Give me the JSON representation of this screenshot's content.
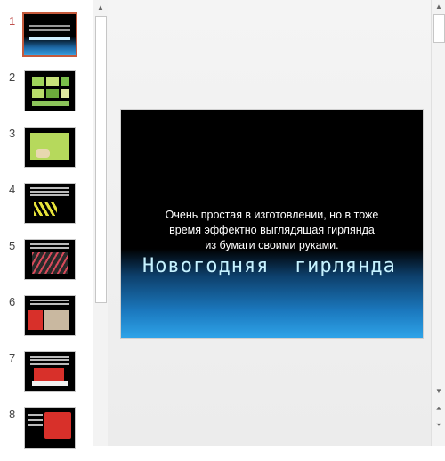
{
  "thumbnails": [
    {
      "number": "1",
      "selected": true
    },
    {
      "number": "2",
      "selected": false
    },
    {
      "number": "3",
      "selected": false
    },
    {
      "number": "4",
      "selected": false
    },
    {
      "number": "5",
      "selected": false
    },
    {
      "number": "6",
      "selected": false
    },
    {
      "number": "7",
      "selected": false
    },
    {
      "number": "8",
      "selected": false
    }
  ],
  "slide": {
    "subtitle_line1": "Очень простая в изготовлении, но в тоже",
    "subtitle_line2": "время эффектно выглядящая гирлянда",
    "subtitle_line3": "из бумаги своими руками.",
    "title": "Новогодняя  гирлянда"
  },
  "colors": {
    "selection_border": "#c55a3c",
    "active_number": "#c0504d",
    "title_text": "#c6f2ff"
  },
  "icons": {
    "scroll_up": "▲",
    "scroll_down": "▼",
    "prev_slide": "⏶",
    "next_slide": "⏷"
  }
}
